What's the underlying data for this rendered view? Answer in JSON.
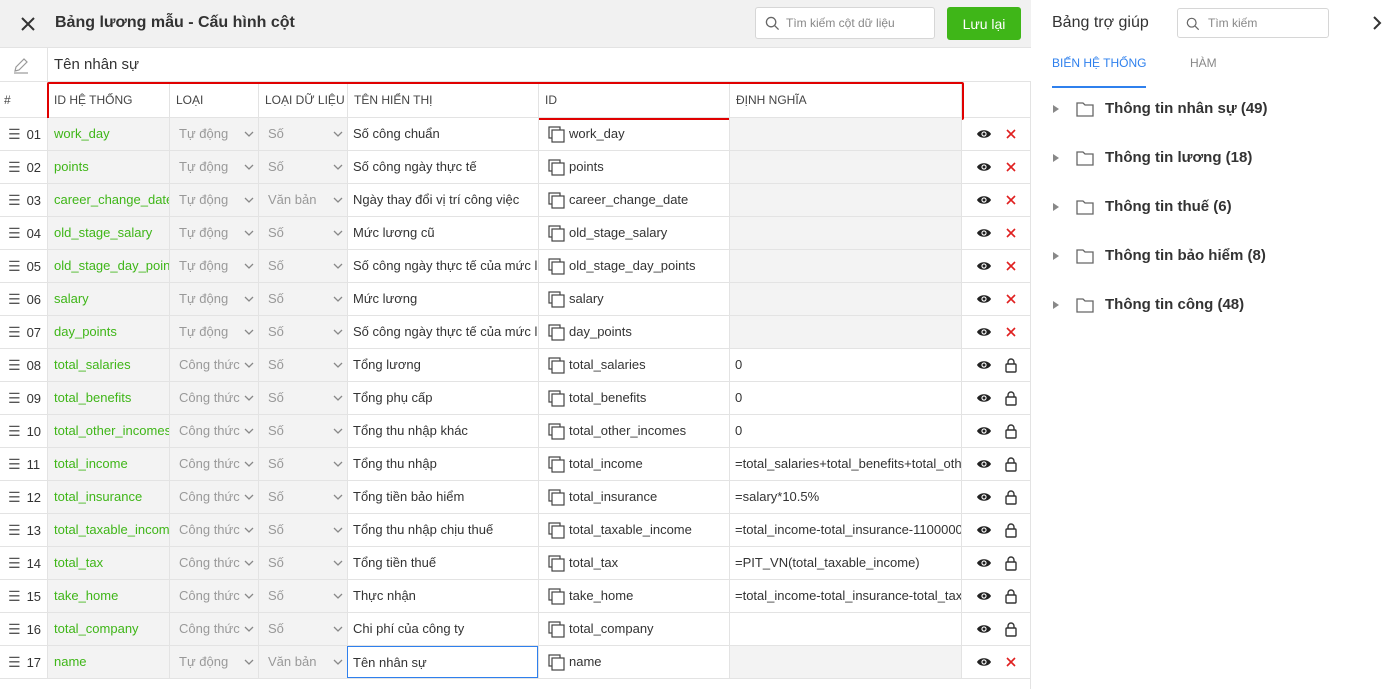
{
  "header": {
    "title": "Bảng lương mẫu - Cấu hình cột",
    "search_placeholder": "Tìm kiếm cột dữ liệu",
    "save_label": "Lưu lại"
  },
  "name_field": {
    "value": "Tên nhân sự"
  },
  "columns": {
    "num": "#",
    "sys_id": "ID HỆ THỐNG",
    "type": "LOẠI",
    "data_type": "LOẠI DỮ LIỆU",
    "display": "TÊN HIỂN THỊ",
    "id": "ID",
    "definition": "ĐỊNH NGHĨA"
  },
  "rows": [
    {
      "num": "01",
      "sys": "work_day",
      "type": "Tự động",
      "dtype": "Số",
      "display": "Số công chuẩn",
      "id": "work_day",
      "def": "",
      "action": "delete"
    },
    {
      "num": "02",
      "sys": "points",
      "type": "Tự động",
      "dtype": "Số",
      "display": "Số công ngày thực tế",
      "id": "points",
      "def": "",
      "action": "delete"
    },
    {
      "num": "03",
      "sys": "career_change_date_",
      "type": "Tự động",
      "dtype": "Văn bản",
      "display": "Ngày thay đổi vị trí công việc",
      "id": "career_change_date",
      "def": "",
      "action": "delete"
    },
    {
      "num": "04",
      "sys": "old_stage_salary",
      "type": "Tự động",
      "dtype": "Số",
      "display": "Mức lương cũ",
      "id": "old_stage_salary",
      "def": "",
      "action": "delete"
    },
    {
      "num": "05",
      "sys": "old_stage_day_points",
      "type": "Tự động",
      "dtype": "Số",
      "display": "Số công ngày thực tế của mức l",
      "id": "old_stage_day_points",
      "def": "",
      "action": "delete"
    },
    {
      "num": "06",
      "sys": "salary",
      "type": "Tự động",
      "dtype": "Số",
      "display": "Mức lương",
      "id": "salary",
      "def": "",
      "action": "delete"
    },
    {
      "num": "07",
      "sys": "day_points",
      "type": "Tự động",
      "dtype": "Số",
      "display": "Số công ngày thực tế của mức l",
      "id": "day_points",
      "def": "",
      "action": "delete"
    },
    {
      "num": "08",
      "sys": "total_salaries",
      "type": "Công thức",
      "dtype": "Số",
      "display": "Tổng lương",
      "id": "total_salaries",
      "def": "0",
      "action": "lock"
    },
    {
      "num": "09",
      "sys": "total_benefits",
      "type": "Công thức",
      "dtype": "Số",
      "display": "Tổng phụ cấp",
      "id": "total_benefits",
      "def": "0",
      "action": "lock"
    },
    {
      "num": "10",
      "sys": "total_other_incomes",
      "type": "Công thức",
      "dtype": "Số",
      "display": "Tổng thu nhập khác",
      "id": "total_other_incomes",
      "def": "0",
      "action": "lock"
    },
    {
      "num": "11",
      "sys": "total_income",
      "type": "Công thức",
      "dtype": "Số",
      "display": "Tổng thu nhập",
      "id": "total_income",
      "def": "=total_salaries+total_benefits+total_oth",
      "action": "lock"
    },
    {
      "num": "12",
      "sys": "total_insurance",
      "type": "Công thức",
      "dtype": "Số",
      "display": "Tổng tiền bảo hiểm",
      "id": "total_insurance",
      "def": "=salary*10.5%",
      "action": "lock"
    },
    {
      "num": "13",
      "sys": "total_taxable_income",
      "type": "Công thức",
      "dtype": "Số",
      "display": "Tổng thu nhập chịu thuế",
      "id": "total_taxable_income",
      "def": "=total_income-total_insurance-1100000",
      "action": "lock"
    },
    {
      "num": "14",
      "sys": "total_tax",
      "type": "Công thức",
      "dtype": "Số",
      "display": "Tổng tiền thuế",
      "id": "total_tax",
      "def": "=PIT_VN(total_taxable_income)",
      "action": "lock"
    },
    {
      "num": "15",
      "sys": "take_home",
      "type": "Công thức",
      "dtype": "Số",
      "display": "Thực nhận",
      "id": "take_home",
      "def": "=total_income-total_insurance-total_tax",
      "action": "lock"
    },
    {
      "num": "16",
      "sys": "total_company",
      "type": "Công thức",
      "dtype": "Số",
      "display": "Chi phí của công ty",
      "id": "total_company",
      "def": "",
      "action": "lock"
    },
    {
      "num": "17",
      "sys": "name",
      "type": "Tự động",
      "dtype": "Văn bản",
      "display": "Tên nhân sự",
      "id": "name",
      "def": "",
      "action": "delete"
    }
  ],
  "help": {
    "title": "Bảng trợ giúp",
    "search_placeholder": "Tìm kiếm",
    "tabs": [
      "BIẾN HỆ THỐNG",
      "HÀM"
    ],
    "tree": [
      "Thông tin nhân sự (49)",
      "Thông tin lương (18)",
      "Thông tin thuế (6)",
      "Thông tin bảo hiểm (8)",
      "Thông tin công (48)"
    ]
  },
  "colors": {
    "accent_green": "#3fb618",
    "accent_blue": "#2f80ed",
    "highlight_red": "#e00000",
    "delete_red": "#e02020"
  },
  "icons": [
    "close-icon",
    "search-icon",
    "pencil-icon",
    "drag-handle-icon",
    "caret-down-icon",
    "copy-icon",
    "eye-icon",
    "delete-icon",
    "lock-icon",
    "chevron-right-icon",
    "triangle-right-icon",
    "folder-icon"
  ]
}
